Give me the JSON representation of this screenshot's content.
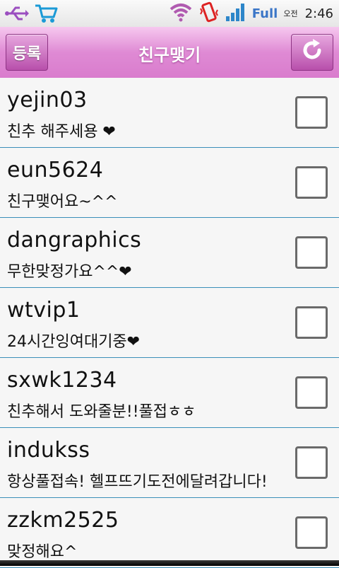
{
  "status_bar": {
    "network": "Full",
    "ampm": "오전",
    "time": "2:46"
  },
  "header": {
    "register_label": "등록",
    "title": "친구맺기"
  },
  "friends": [
    {
      "username": "yejin03",
      "message": "친추 해주세용 ❤"
    },
    {
      "username": "eun5624",
      "message": "친구맺어요~^^"
    },
    {
      "username": "dangraphics",
      "message": "무한맞정가요^^❤"
    },
    {
      "username": "wtvip1",
      "message": "24시간잉여대기중❤"
    },
    {
      "username": "sxwk1234",
      "message": "친추해서 도와줄분!!풀접ㅎㅎ"
    },
    {
      "username": "indukss",
      "message": "항상풀접속! 헬프뜨기도전에달려갑니다!"
    },
    {
      "username": "zzkm2525",
      "message": "맞정해요^"
    }
  ]
}
